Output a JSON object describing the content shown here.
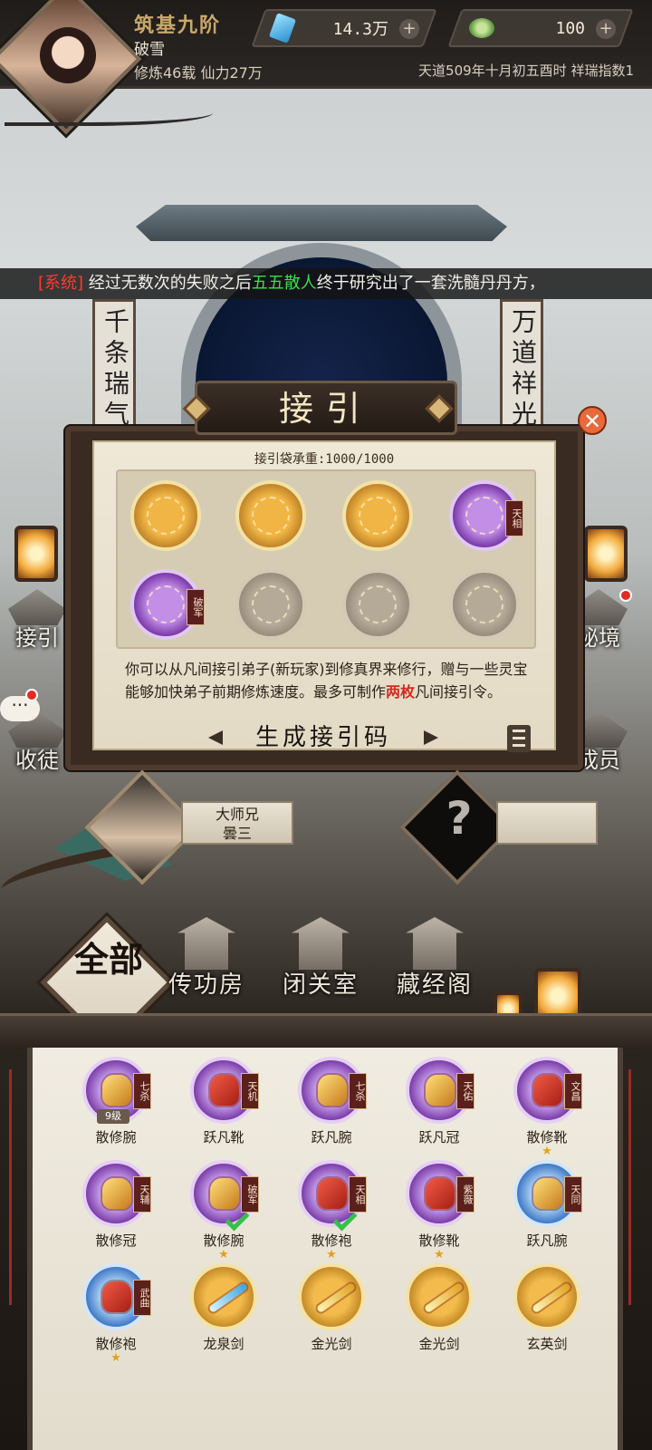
{
  "player": {
    "rank": "筑基九阶",
    "name": "破雪",
    "stats": "修炼46载  仙力27万"
  },
  "resources": {
    "gems": "14.3万",
    "coins": "100",
    "plus": "+"
  },
  "world_info": "天道509年十月初五酉时  祥瑞指数1",
  "marquee": {
    "tag": "[系统]",
    "text_before": " 经过无数次的失败之后",
    "name": "五五散人",
    "text_after": "终于研究出了一套洗髓丹丹方，"
  },
  "couplets": {
    "left": "千条瑞气",
    "right": "万道祥光"
  },
  "side_buttons": {
    "recruit": "接引",
    "secret": "秘境",
    "residence": "收徒",
    "members": "成员",
    "chat": "···"
  },
  "dialog": {
    "title": "接引",
    "close": "✕",
    "capacity": "接引袋承重:1000/1000",
    "slots": [
      {
        "type": "weapon",
        "tag": ""
      },
      {
        "type": "weapon",
        "tag": ""
      },
      {
        "type": "weapon",
        "tag": ""
      },
      {
        "type": "purple",
        "tag": "天相"
      },
      {
        "type": "purple",
        "tag": "破军"
      },
      {
        "type": "empty",
        "tag": ""
      },
      {
        "type": "empty",
        "tag": ""
      },
      {
        "type": "empty",
        "tag": ""
      }
    ],
    "description_before": "你可以从凡间接引弟子(新玩家)到修真界来修行，赠与一些灵宝能够加快弟子前期修炼速度。最多可制作",
    "description_highlight": "两枚",
    "description_after": "凡间接引令。",
    "generate_button": "生成接引码"
  },
  "disciple": {
    "title": "大师兄",
    "name": "曇三",
    "unknown": "?"
  },
  "tabs": {
    "all": "全部",
    "transmit": "传功房",
    "retreat": "闭关室",
    "library": "藏经阁"
  },
  "inventory": [
    {
      "name": "散修腕",
      "orb": "purple",
      "tag": "七杀",
      "level": "9级",
      "check": false,
      "stars": ""
    },
    {
      "name": "跃凡靴",
      "orb": "purple",
      "tag": "天机",
      "level": "",
      "check": false,
      "stars": ""
    },
    {
      "name": "跃凡腕",
      "orb": "purple",
      "tag": "七杀",
      "level": "",
      "check": false,
      "stars": ""
    },
    {
      "name": "跃凡冠",
      "orb": "purple",
      "tag": "天佑",
      "level": "",
      "check": false,
      "stars": ""
    },
    {
      "name": "散修靴",
      "orb": "purple",
      "tag": "文昌",
      "level": "",
      "check": false,
      "stars": "★"
    },
    {
      "name": "散修冠",
      "orb": "purple",
      "tag": "天辅",
      "level": "",
      "check": false,
      "stars": ""
    },
    {
      "name": "散修腕",
      "orb": "purple",
      "tag": "破军",
      "level": "",
      "check": true,
      "stars": "★"
    },
    {
      "name": "散修袍",
      "orb": "purple",
      "tag": "天相",
      "level": "",
      "check": true,
      "stars": "★"
    },
    {
      "name": "散修靴",
      "orb": "purple",
      "tag": "紫薇",
      "level": "",
      "check": false,
      "stars": "★"
    },
    {
      "name": "跃凡腕",
      "orb": "blue",
      "tag": "天同",
      "level": "",
      "check": false,
      "stars": ""
    },
    {
      "name": "散修袍",
      "orb": "blue",
      "tag": "武曲",
      "level": "",
      "check": false,
      "stars": "★"
    },
    {
      "name": "龙泉剑",
      "orb": "gold",
      "tag": "",
      "level": "",
      "check": false,
      "stars": ""
    },
    {
      "name": "金光剑",
      "orb": "gold",
      "tag": "",
      "level": "",
      "check": false,
      "stars": ""
    },
    {
      "name": "金光剑",
      "orb": "gold",
      "tag": "",
      "level": "",
      "check": false,
      "stars": ""
    },
    {
      "name": "玄英剑",
      "orb": "gold",
      "tag": "",
      "level": "",
      "check": false,
      "stars": ""
    }
  ]
}
